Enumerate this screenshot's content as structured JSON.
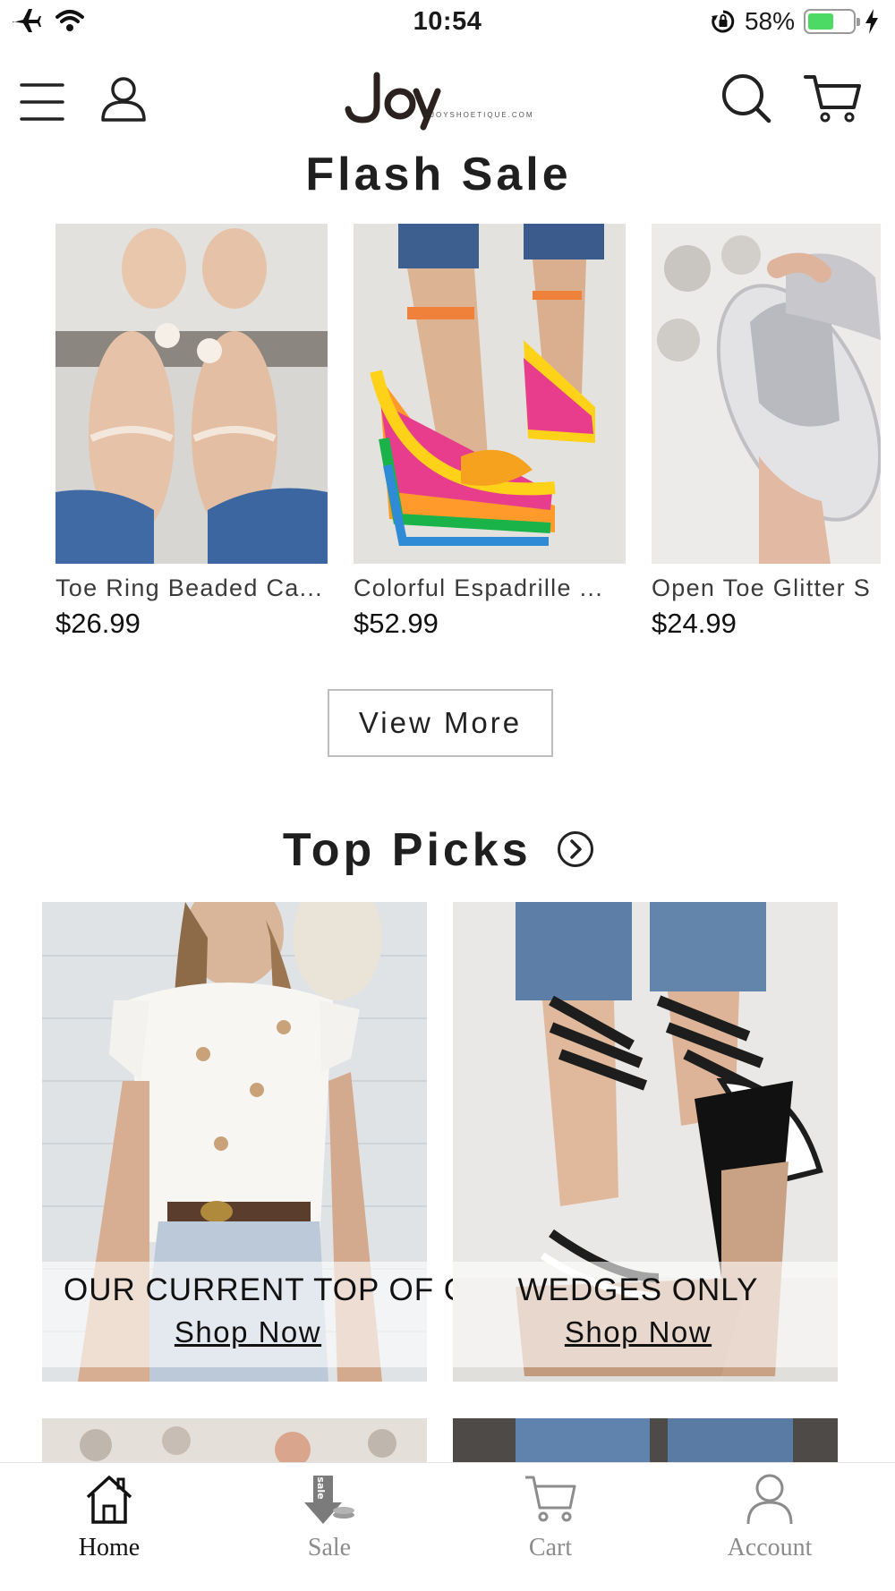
{
  "status_bar": {
    "time": "10:54",
    "battery_percent": "58%",
    "battery_level": 0.58,
    "battery_color": "#4cd964"
  },
  "header": {
    "logo_text": "JOY",
    "logo_subtext": "JOYSHOETIQUE.COM",
    "icons": [
      "menu-icon",
      "user-icon",
      "search-icon",
      "cart-icon"
    ]
  },
  "flash_sale": {
    "title": "Flash Sale",
    "products": [
      {
        "name": "Toe Ring Beaded Ca...",
        "price": "$26.99"
      },
      {
        "name": "Colorful Espadrille ...",
        "price": "$52.99"
      },
      {
        "name": "Open Toe Glitter S",
        "price": "$24.99"
      }
    ],
    "view_more_label": "View More"
  },
  "top_picks": {
    "title": "Top Picks",
    "items": [
      {
        "headline": "OUR CURRENT TOP OF C",
        "cta": "Shop Now"
      },
      {
        "headline": "WEDGES ONLY",
        "cta": "Shop Now"
      }
    ]
  },
  "tab_bar": {
    "active": "Home",
    "tabs": [
      {
        "label": "Home",
        "icon": "home-icon"
      },
      {
        "label": "Sale",
        "icon": "sale-tag-icon",
        "badge_text": "sale"
      },
      {
        "label": "Cart",
        "icon": "cart-icon"
      },
      {
        "label": "Account",
        "icon": "account-icon"
      }
    ]
  }
}
